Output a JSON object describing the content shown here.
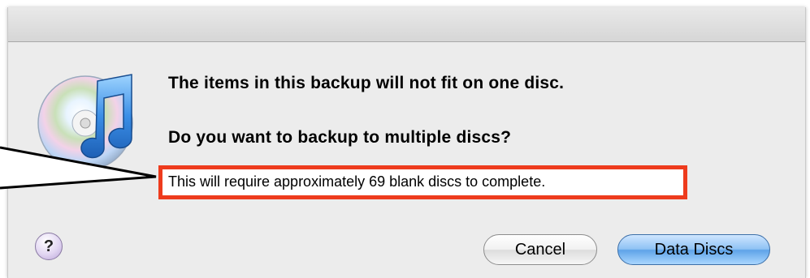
{
  "dialog": {
    "message_main": "The items in this backup will not fit on one disc.",
    "message_question": "Do you want to backup to multiple discs?",
    "message_info": "This will require approximately 69 blank discs to complete.",
    "help_label": "?",
    "cancel_label": "Cancel",
    "default_label": "Data Discs",
    "app_icon": "itunes-cd-music-note-icon"
  },
  "colors": {
    "highlight": "#ee3b1d",
    "default_button": "#5ea3e8",
    "dialog_background": "#ececec"
  }
}
